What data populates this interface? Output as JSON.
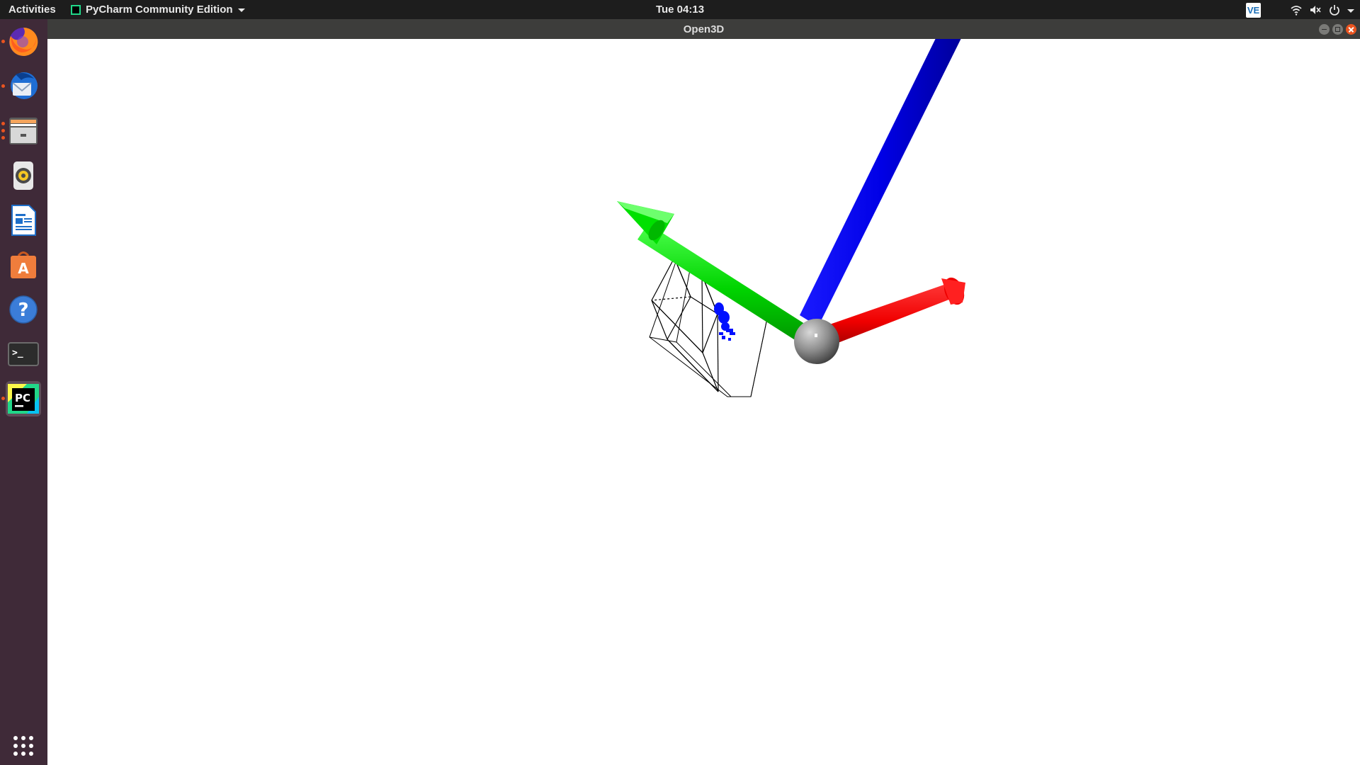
{
  "topbar": {
    "activities_label": "Activities",
    "app_menu_label": "PyCharm Community Edition",
    "clock": "Tue 04:13",
    "tray_app_label": "VE"
  },
  "window": {
    "title": "Open3D"
  },
  "dock": {
    "items": [
      {
        "name": "firefox",
        "icon": "firefox-icon",
        "running": true
      },
      {
        "name": "thunderbird",
        "icon": "thunderbird-icon",
        "running": true
      },
      {
        "name": "files",
        "icon": "files-icon",
        "running": true
      },
      {
        "name": "rhythmbox",
        "icon": "rhythmbox-icon",
        "running": false
      },
      {
        "name": "libreoffice-writer",
        "icon": "writer-icon",
        "running": false
      },
      {
        "name": "ubuntu-software",
        "icon": "software-store-icon",
        "running": false
      },
      {
        "name": "help",
        "icon": "help-icon",
        "running": false
      },
      {
        "name": "terminal",
        "icon": "terminal-icon",
        "running": false
      },
      {
        "name": "pycharm",
        "icon": "pycharm-icon",
        "running": true,
        "active": true
      },
      {
        "name": "show-applications",
        "icon": "app-grid-icon",
        "running": false
      }
    ],
    "terminal_glyph": ">_",
    "pycharm_glyph": "PC",
    "help_glyph": "?",
    "store_glyph": "A"
  },
  "scene": {
    "axis_colors": {
      "x": "#ff0000",
      "y": "#00cc00",
      "z": "#0000ee",
      "origin": "#9a9a9a"
    },
    "point_cloud_color": "#0010ff",
    "bounding_box_color": "#000000",
    "background": "#ffffff"
  }
}
